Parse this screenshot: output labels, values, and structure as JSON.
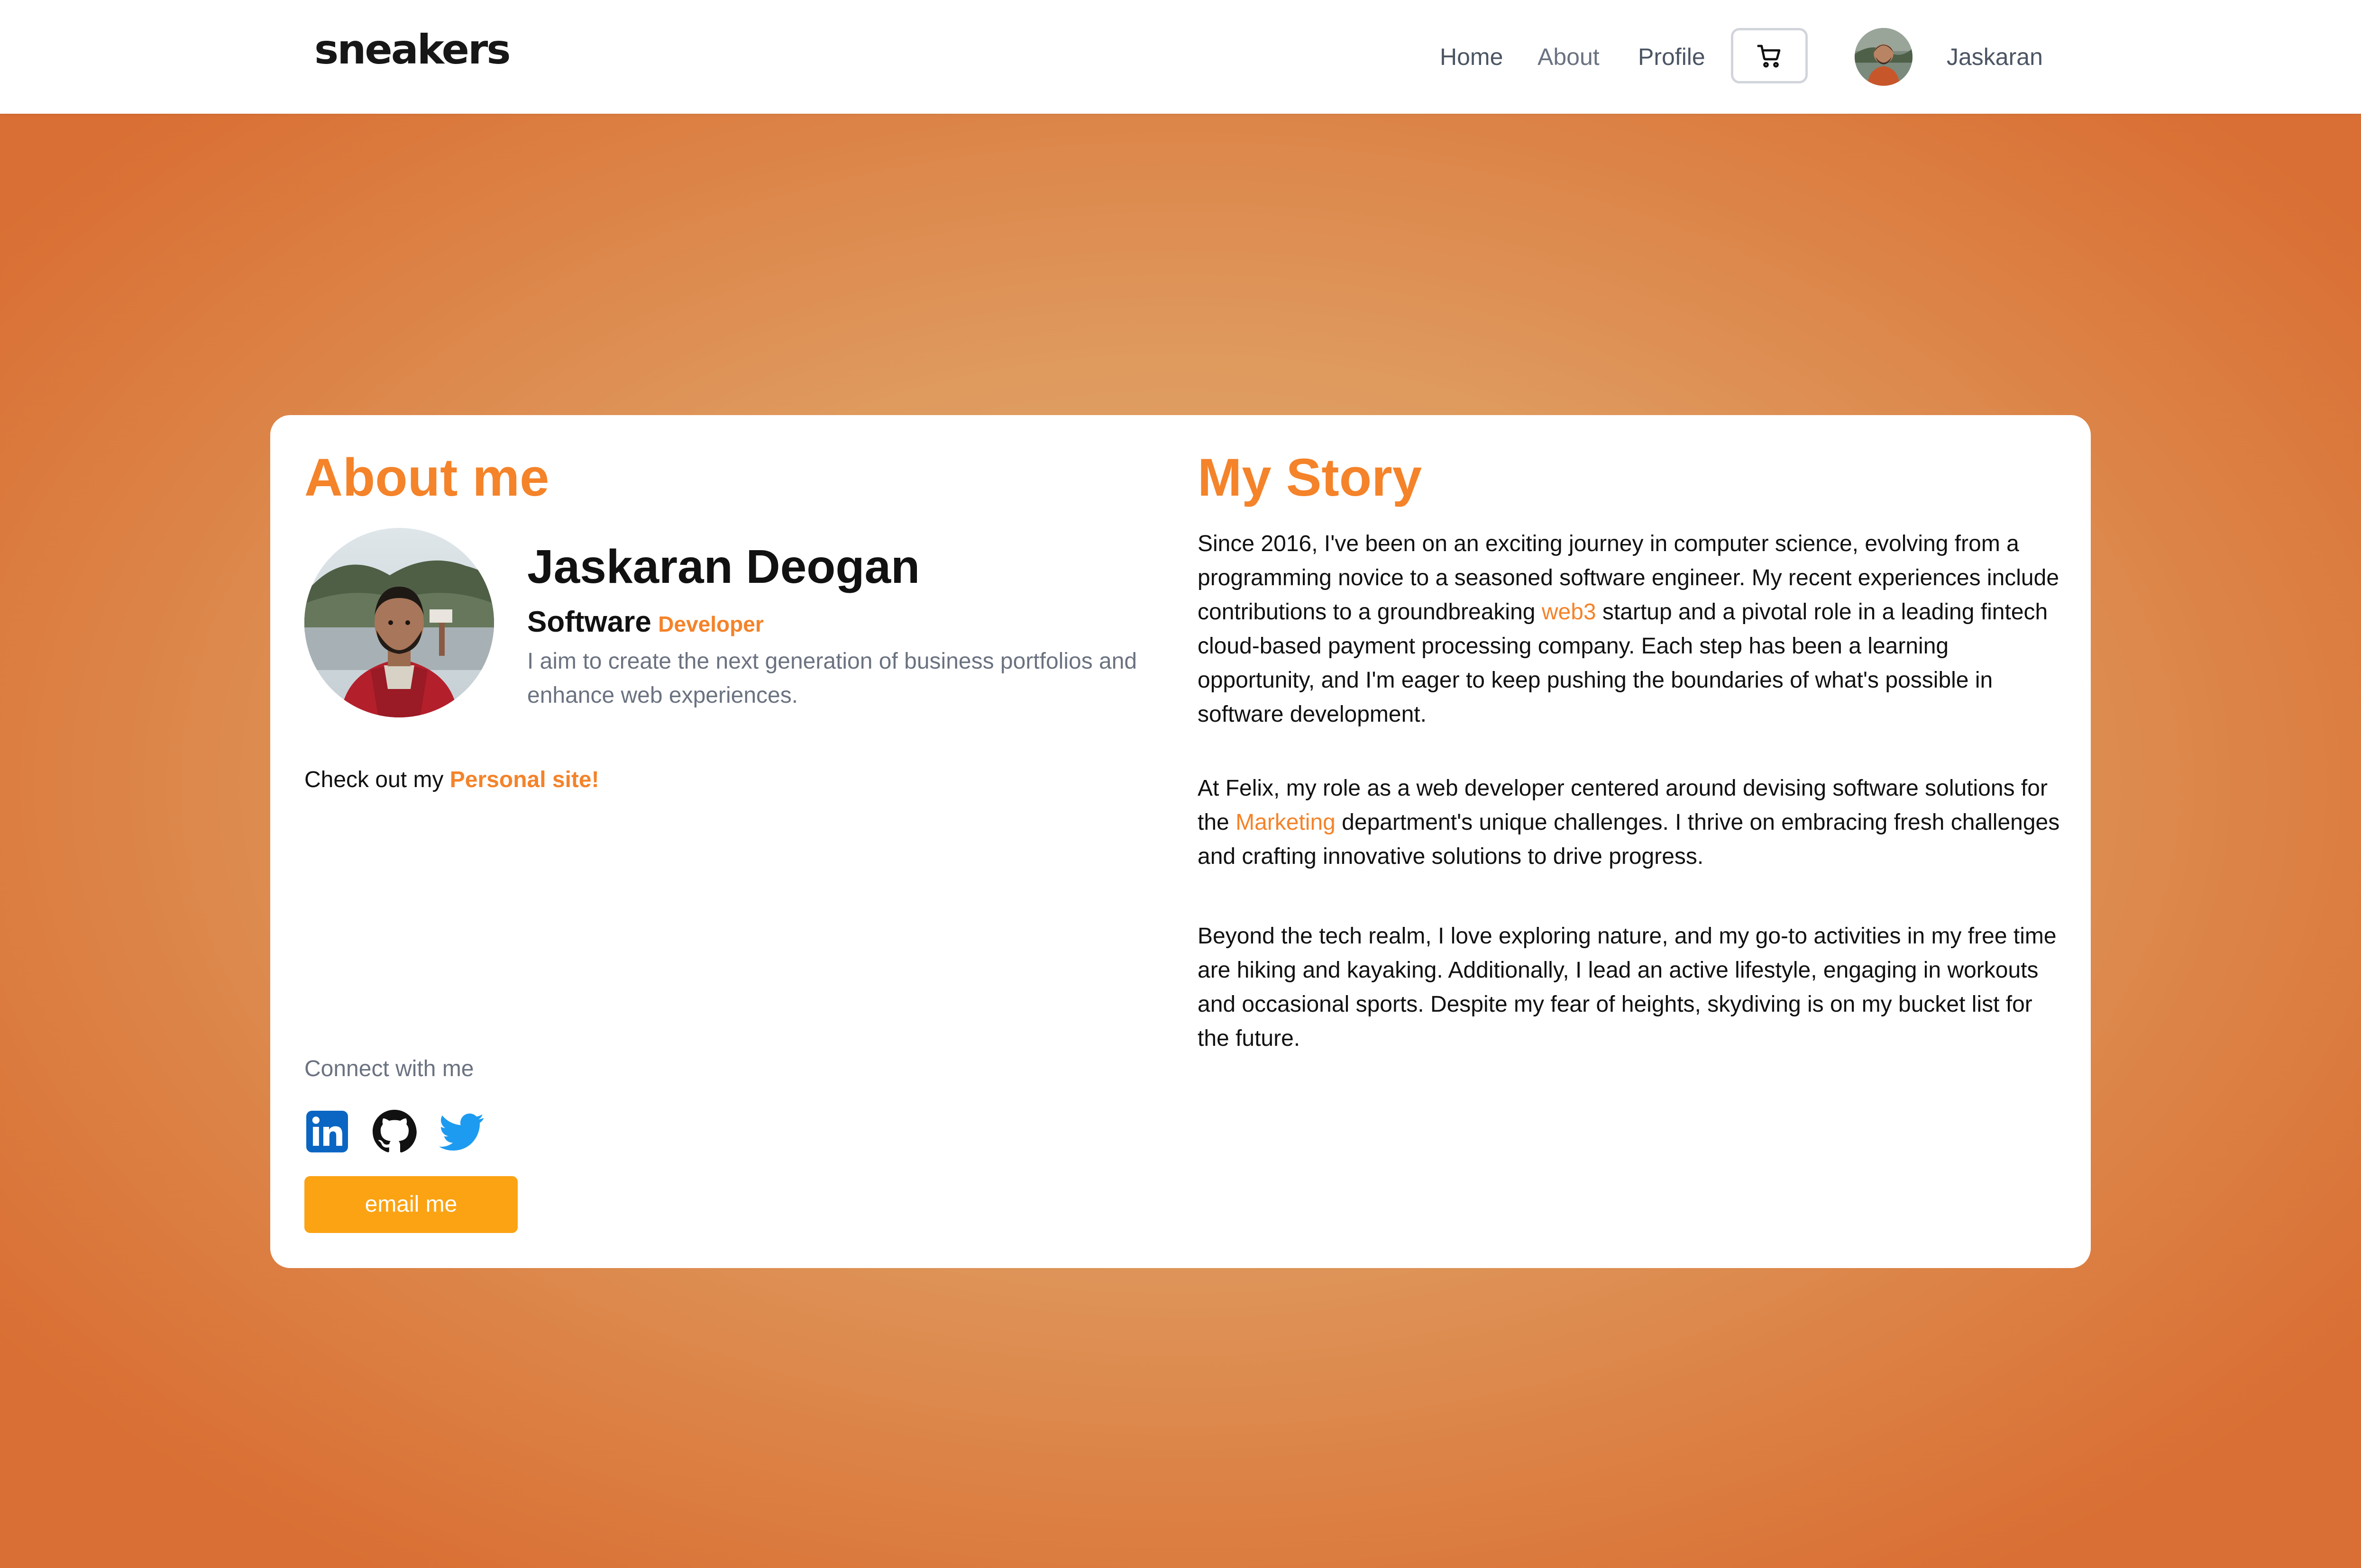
{
  "nav": {
    "brand": "sneakers",
    "links": [
      {
        "label": "Home"
      },
      {
        "label": "About"
      },
      {
        "label": "Profile"
      }
    ],
    "cart_icon": "cart-icon",
    "user_name": "Jaskaran"
  },
  "about": {
    "heading": "About me",
    "name": "Jaskaran Deogan",
    "role_main": "Software",
    "role_sub": "Developer",
    "tagline": "I aim to create the next generation of business portfolios and enhance web experiences.",
    "site_prefix": "Check out my",
    "site_link": "Personal site!",
    "connect_label": "Connect with me",
    "social": [
      "linkedin-icon",
      "github-icon",
      "twitter-icon"
    ],
    "email_button": "email me"
  },
  "story": {
    "heading": "My Story",
    "p1": {
      "a": "Since 2016, I've been on an exciting journey in computer science, evolving from a programming novice to a seasoned software engineer. My recent experiences include contributions to a groundbreaking",
      "highlight": "web3",
      "b": "startup and a pivotal role in a leading fintech cloud-based payment processing company. Each step has been a learning opportunity, and I'm eager to keep pushing the boundaries of what's possible in software development."
    },
    "p2": {
      "a": "At Felix, my role as a web developer centered around devising software solutions for the",
      "highlight": "Marketing",
      "b": "department's unique challenges. I thrive on embracing fresh challenges and crafting innovative solutions to drive progress."
    },
    "p3": "Beyond the tech realm, I love exploring nature, and my go-to activities in my free time are hiking and kayaking. Additionally, I lead an active lifestyle, engaging in workouts and occasional sports. Despite my fear of heights, skydiving is on my bucket list for the future."
  },
  "colors": {
    "accent": "#f4832a",
    "button": "#fba313",
    "background": "#df9a5e"
  }
}
